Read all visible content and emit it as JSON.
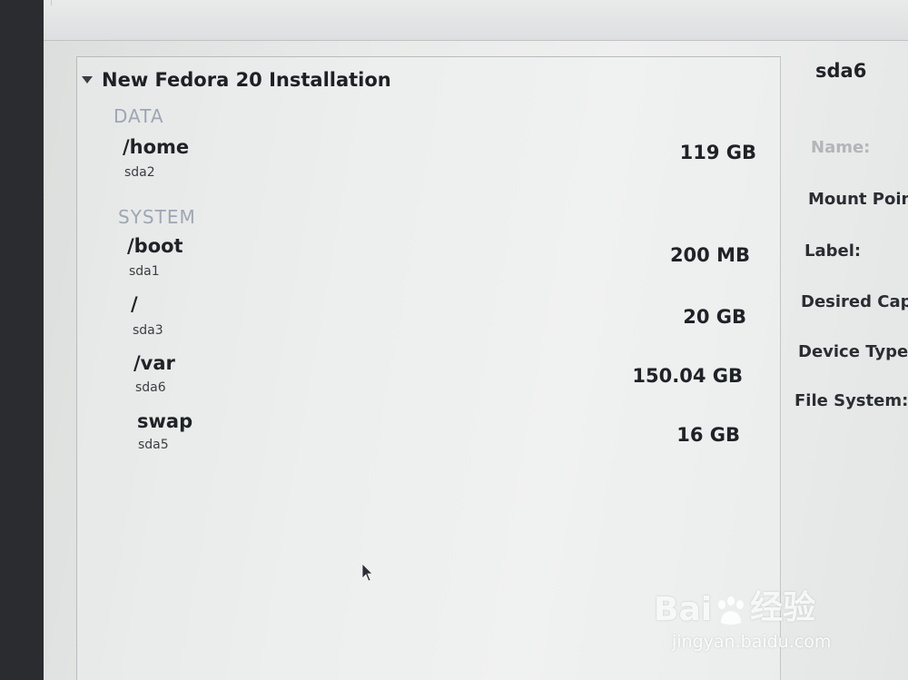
{
  "installation": {
    "title": "New Fedora 20 Installation",
    "groups": [
      {
        "label": "DATA",
        "mounts": [
          {
            "mount": "/home",
            "device": "sda2",
            "size": "119 GB"
          }
        ]
      },
      {
        "label": "SYSTEM",
        "mounts": [
          {
            "mount": "/boot",
            "device": "sda1",
            "size": "200 MB"
          },
          {
            "mount": "/",
            "device": "sda3",
            "size": "20 GB"
          },
          {
            "mount": "/var",
            "device": "sda6",
            "size": "150.04 GB"
          },
          {
            "mount": "swap",
            "device": "sda5",
            "size": "16 GB"
          }
        ]
      }
    ]
  },
  "details": {
    "selected_device": "sda6",
    "labels": {
      "name": "Name:",
      "mount_point": "Mount Poin",
      "label": "Label:",
      "desired_capacity": "Desired Cap",
      "device_type": "Device Type:",
      "file_system": "File System:"
    }
  },
  "watermark": {
    "brand_left": "Bai",
    "brand_right": "经验",
    "url": "jingyan.baidu.com"
  }
}
